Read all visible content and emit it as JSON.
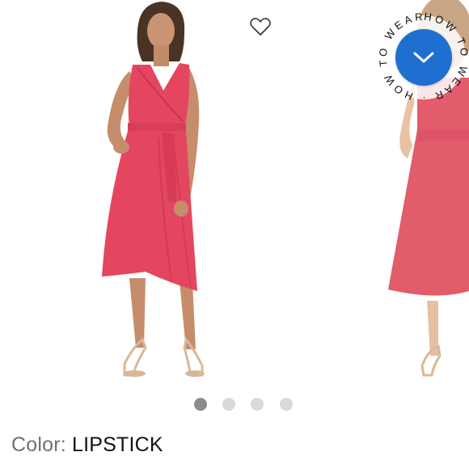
{
  "colors": {
    "dress": "#e4465f",
    "dress_peek": "#e35c6c",
    "accent_button": "#1f6fd1",
    "active_dot": "#8c8c8c",
    "inactive_dot": "#d9d9d9"
  },
  "gallery": {
    "wishlist_icon": "heart-outline-icon",
    "how_to_wear": {
      "badge_text": "HOW TO WEAR · HOW TO WEAR ·",
      "button_icon": "chevron-down-icon"
    },
    "pagination": {
      "total": 4,
      "active_index": 0
    }
  },
  "product": {
    "color_label": "Color:",
    "color_value": "LIPSTICK"
  }
}
